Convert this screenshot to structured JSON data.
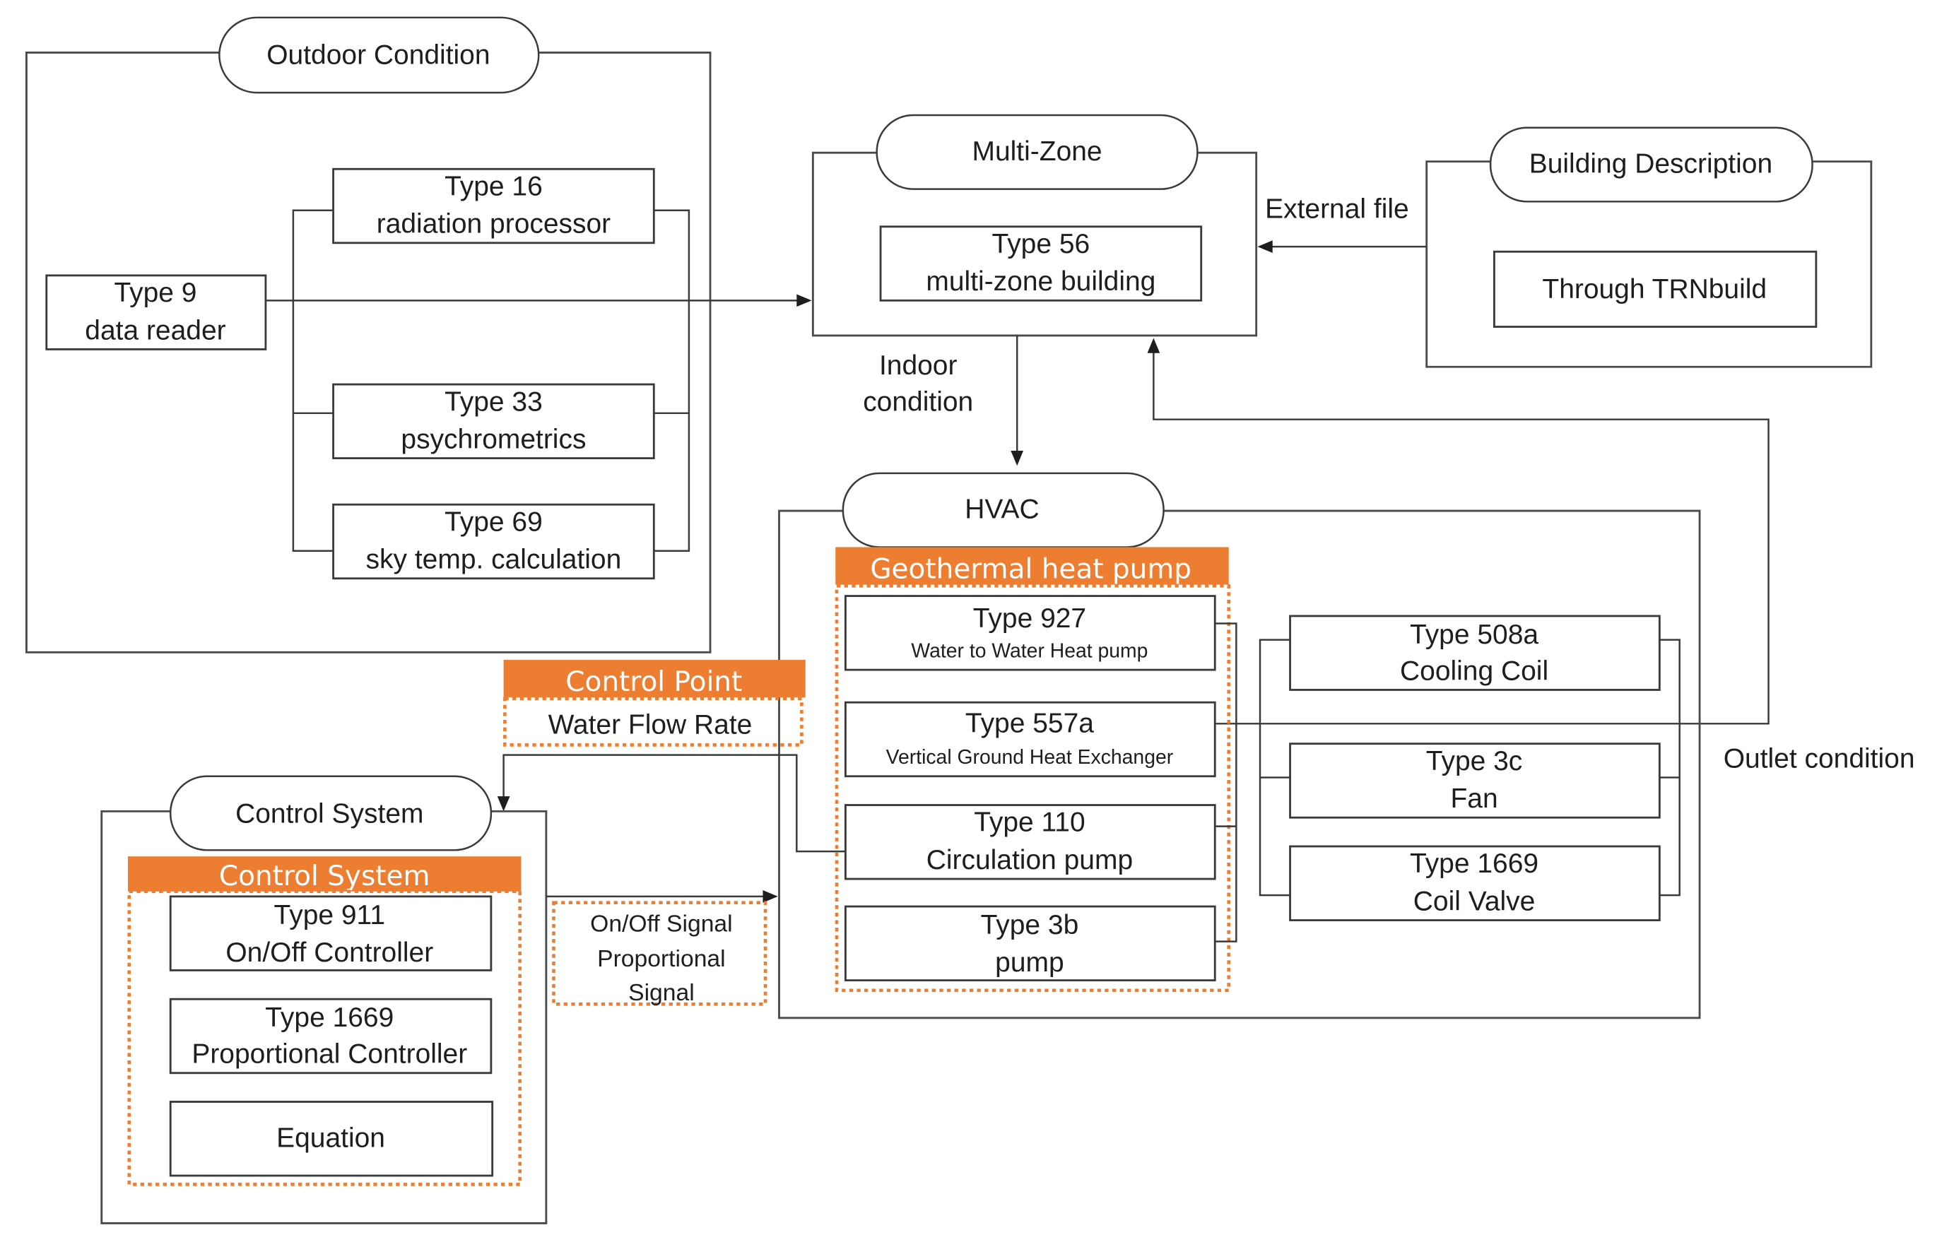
{
  "colors": {
    "accent_orange": "#ED7D31",
    "line": "#3a3a3a",
    "text": "#1e1e1e",
    "background": "#ffffff"
  },
  "outdoor": {
    "title": "Outdoor Condition",
    "type9": {
      "line1": "Type 9",
      "line2": "data reader"
    },
    "type16": {
      "line1": "Type 16",
      "line2": "radiation processor"
    },
    "type33": {
      "line1": "Type 33",
      "line2": "psychrometrics"
    },
    "type69": {
      "line1": "Type 69",
      "line2": "sky temp. calculation"
    }
  },
  "multizone": {
    "title": "Multi-Zone",
    "type56": {
      "line1": "Type 56",
      "line2": "multi-zone building"
    }
  },
  "building": {
    "title": "Building Description",
    "trnbuild": "Through TRNbuild"
  },
  "labels": {
    "external_file": "External file",
    "indoor_condition_1": "Indoor",
    "indoor_condition_2": "condition",
    "outlet_condition": "Outlet condition"
  },
  "hvac": {
    "title": "HVAC",
    "geothermal_band": "Geothermal heat  pump",
    "type927": {
      "line1": "Type 927",
      "line2": "Water to Water Heat pump"
    },
    "type557a": {
      "line1": "Type 557a",
      "line2": "Vertical Ground Heat Exchanger"
    },
    "type110": {
      "line1": "Type 110",
      "line2": "Circulation pump"
    },
    "type3b": {
      "line1": "Type 3b",
      "line2": "pump"
    },
    "type508a": {
      "line1": "Type 508a",
      "line2": "Cooling Coil"
    },
    "type3c": {
      "line1": "Type 3c",
      "line2": "Fan"
    },
    "type1669": {
      "line1": "Type 1669",
      "line2": "Coil Valve"
    }
  },
  "control_point": {
    "band": "Control Point",
    "value": "Water Flow Rate"
  },
  "control": {
    "title": "Control System",
    "band": "Control System",
    "type911": {
      "line1": "Type 911",
      "line2": "On/Off Controller"
    },
    "type1669": {
      "line1": "Type 1669",
      "line2": "Proportional  Controller"
    },
    "equation": "Equation"
  },
  "signal": {
    "line1": "On/Off Signal",
    "line2": "Proportional",
    "line3": "Signal"
  }
}
